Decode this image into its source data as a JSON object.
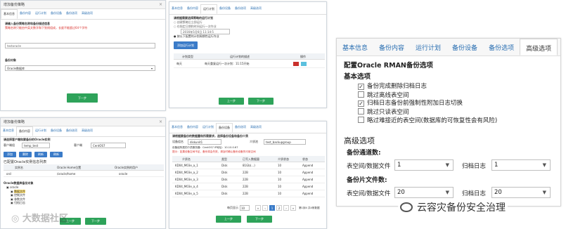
{
  "p1": {
    "title": "增加备份策略",
    "tabs": [
      "基本信息",
      "备份内容",
      "运行计划",
      "备份设备",
      "备份选项",
      "高级选项"
    ],
    "label1": "请输入备份策略名称和备份描述信息",
    "warn": "策略名称只能由中英文数字和下划线组成，长度不能超过64个字符",
    "name_value": "testoracle",
    "label2": "备份对象",
    "select_value": "Oracle数据库",
    "next": "下一步"
  },
  "p2": {
    "tabs": [
      "基本信息",
      "备份内容",
      "运行计划",
      "备份设备",
      "备份选项",
      "高级选项"
    ],
    "heading": "请根据需要选择策略的运行计划",
    "opt1": "创建策略后立即运行",
    "opt2": "在指定日期和时间运行一次作业",
    "date": "2016年5月6日 11:14:5",
    "opt3": "按以下配置的计划周期性运行作业",
    "add": "添加运行计划",
    "col1": "计划类型",
    "col2": "运行计划的描述",
    "col3": "操作",
    "row_type": "每天",
    "row_desc": "每天重复运行一次计划：11:15开始",
    "prev": "上一步",
    "next": "下一步"
  },
  "p3": {
    "title": "增加备份策略",
    "tabs": [
      "基本信息",
      "备份内容",
      "运行计划",
      "备份设备",
      "备份选项",
      "高级选项"
    ],
    "note": "请选择客户端和要备份的Oracle实例",
    "client_label": "客户端组",
    "client_value": "temp_test",
    "host_label": "客户端",
    "host_value": "CentOS7",
    "b1": "添加",
    "b2": "删除",
    "b3": "刷新",
    "b4": "刷新",
    "sub": "已配置Oracle实例信息列表",
    "col1": "实例名",
    "col2": "Oracle Home位置",
    "col3": "Oracle实例的用户",
    "r_inst": "orcl",
    "r_home": "/oracle/home",
    "r_user": "oracle",
    "tree_title": "Oracle数据库备份对象",
    "tree": [
      "oracle",
      "数据文件",
      "控制文件",
      "参数文件",
      "归档日志"
    ],
    "prev": "上一步",
    "next": "下一步"
  },
  "p4": {
    "tabs": [
      "基本信息",
      "备份内容",
      "运行计划",
      "备份设备",
      "备份选项",
      "高级选项"
    ],
    "heading": "请根据要备份的数据量和所需要求，选择备份设备和备份介质",
    "dev_label": "设备组名",
    "dev_value": "diskunit1",
    "pool_label": "介质池",
    "pool_value": "test_backupgroup",
    "info1": "设备组所属的介质服务器：CentOS7 IP地址：10.10.0.67",
    "warn": "提示：如果设备空间不足，备份将会失败，请及时确认备份设备的可用空间",
    "headers": [
      "介质名",
      "类型",
      "已写入数据量",
      "介质状态",
      "状态"
    ],
    "rows": [
      [
        "KD04_M03e_a_1",
        "Disk",
        "81Gb(…)",
        "10",
        "Append"
      ],
      [
        "KD04_M03e_a_2",
        "Disk",
        "22B",
        "10",
        "Append"
      ],
      [
        "KD04_M03e_a_3",
        "Disk",
        "22B",
        "10",
        "Append"
      ],
      [
        "KD04_M03e_a_4",
        "Disk",
        "22B",
        "10",
        "Append"
      ],
      [
        "KD04_M03e_a_5",
        "Disk",
        "22B",
        "10",
        "Append"
      ]
    ],
    "pager_label": "每页显示",
    "pager_value": "10",
    "pages": [
      "«",
      "‹",
      "1",
      "2",
      "›",
      "»"
    ],
    "pager_info": "第1到4 共4条数据",
    "prev": "上一步",
    "next": "下一步"
  },
  "p5": {
    "tabs": [
      "基本信息",
      "备份内容",
      "运行计划",
      "备份设备",
      "备份选项",
      "高级选项"
    ],
    "title": "配置Oracle RMAN备份选项",
    "basic": "基本选项",
    "options": [
      {
        "label": "备份完成删除归档日志",
        "checked": true
      },
      {
        "label": "跳过离线表空间",
        "checked": false
      },
      {
        "label": "归档日志备份前强制性附加日志切换",
        "checked": true
      },
      {
        "label": "跳过只读表空间",
        "checked": false
      },
      {
        "label": "略过难接近的表空间(数据库的可恢复性会有风险)",
        "checked": false
      }
    ],
    "advanced": "高级选项",
    "channels": "备份通道数:",
    "ts_label": "表空间/数据文件",
    "ts_channels": "1",
    "arc_label": "归档日志",
    "arc_channels": "1",
    "files": "备份片文件数:",
    "ts_files": "20",
    "arc_files": "20"
  },
  "watermark": {
    "left": "大数据社区",
    "right": "云容灾备份安全治理"
  }
}
